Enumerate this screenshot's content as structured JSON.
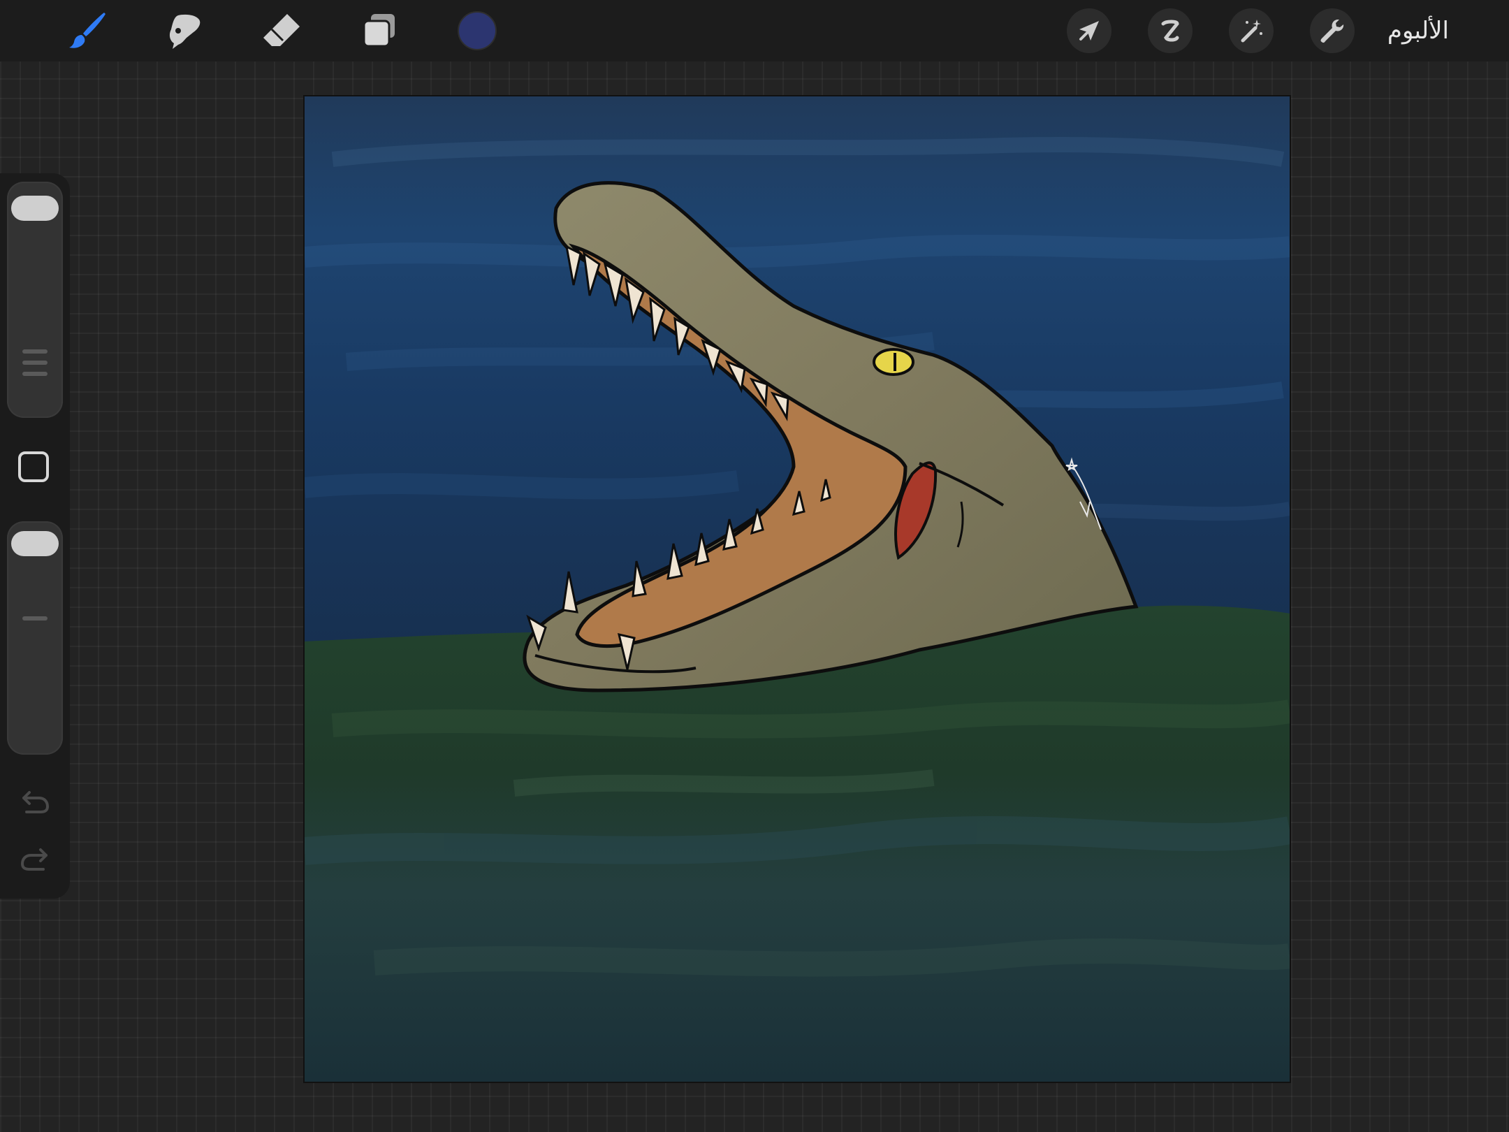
{
  "toolbar": {
    "left_tools": [
      {
        "name": "brush",
        "icon": "brush-icon",
        "active": true
      },
      {
        "name": "smudge",
        "icon": "smudge-icon",
        "active": false
      },
      {
        "name": "eraser",
        "icon": "eraser-icon",
        "active": false
      },
      {
        "name": "layers",
        "icon": "layers-icon",
        "active": false
      }
    ],
    "current_color": "#2c3570",
    "right_tools": [
      {
        "name": "transform",
        "icon": "arrow-cursor-icon"
      },
      {
        "name": "selection",
        "icon": "selection-s-icon"
      },
      {
        "name": "adjustments",
        "icon": "magic-wand-icon"
      },
      {
        "name": "actions",
        "icon": "wrench-icon"
      }
    ],
    "gallery_label": "الألبوم"
  },
  "sidebar": {
    "size_slider_level": 1.0,
    "opacity_slider_level": 1.0,
    "undo_icon": "undo-icon",
    "redo_icon": "redo-icon",
    "modify_icon": "square-icon"
  },
  "canvas": {
    "subject": "crocodile-painting",
    "palette": {
      "sky": "#1b3a5e",
      "water": "#22402f",
      "croc_skin": "#8a8468",
      "mouth": "#b07a4a",
      "eye": "#e6d54a",
      "throat": "#a8392a"
    }
  },
  "accent_color": "#2f7bf5"
}
